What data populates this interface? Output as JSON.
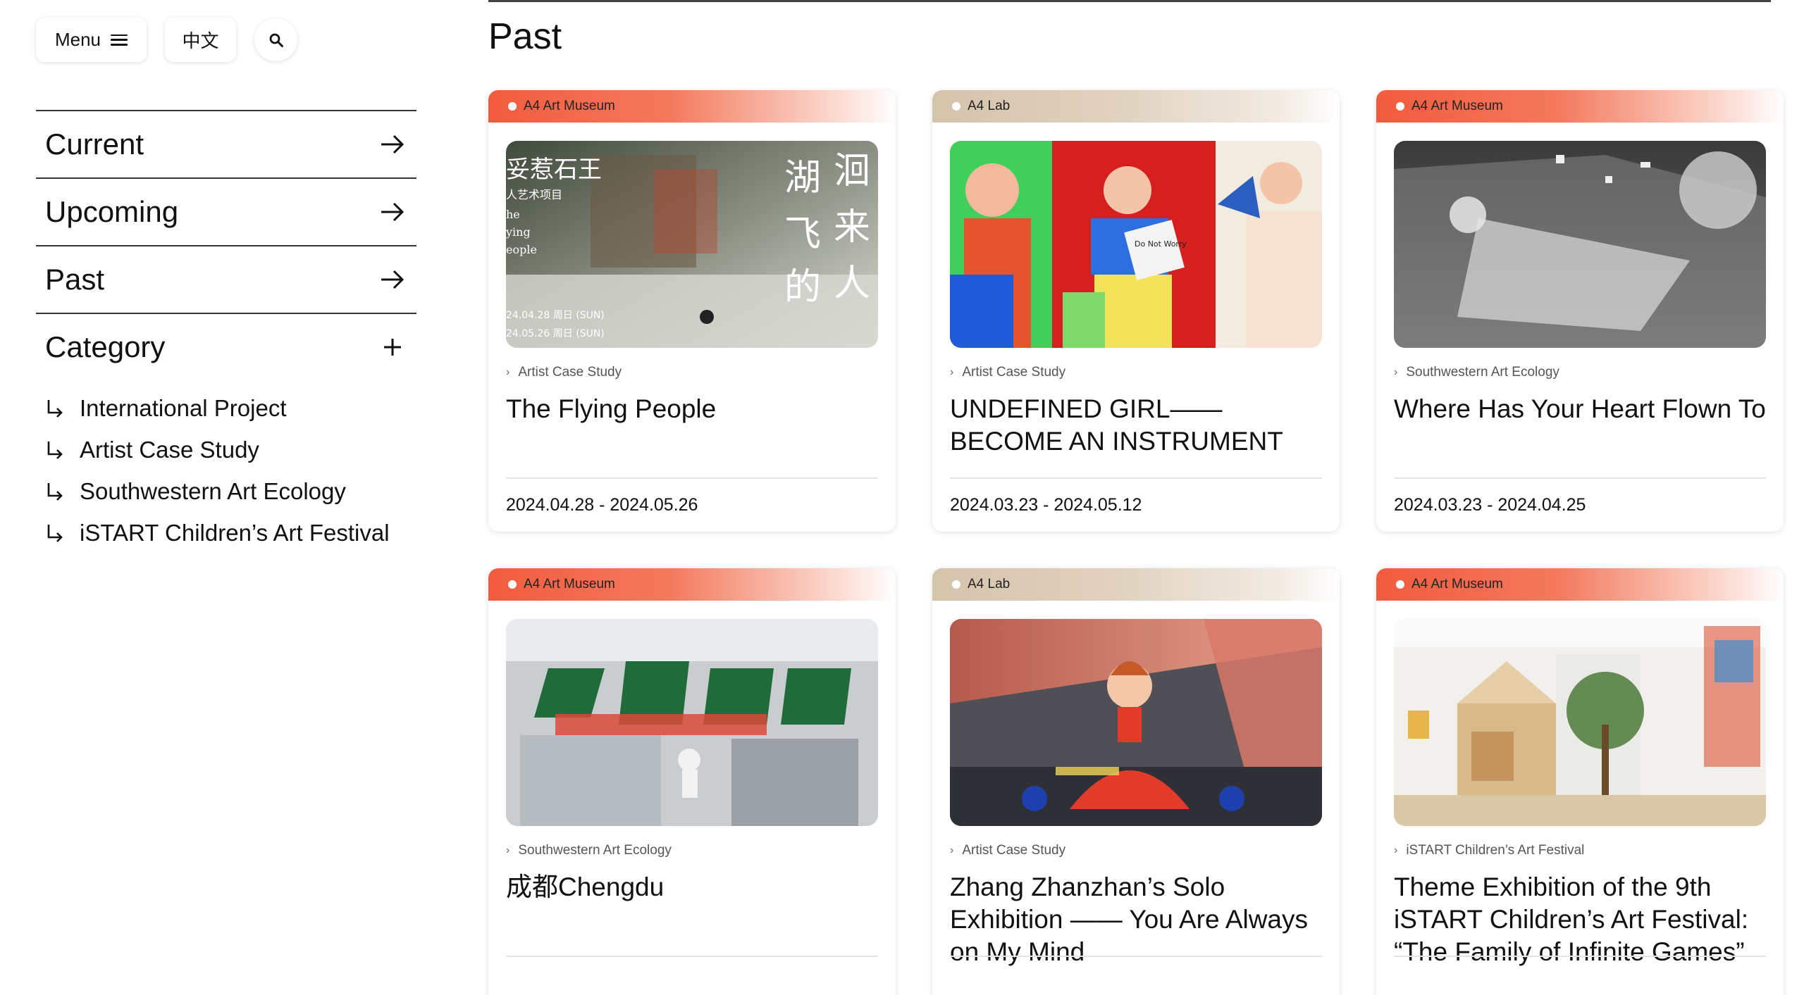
{
  "header": {
    "menu_label": "Menu",
    "lang_label": "中文"
  },
  "sidebar": {
    "nav": [
      {
        "label": "Current"
      },
      {
        "label": "Upcoming"
      },
      {
        "label": "Past"
      },
      {
        "label": "Category"
      }
    ],
    "categories": [
      {
        "label": "International Project"
      },
      {
        "label": "Artist Case Study"
      },
      {
        "label": "Southwestern Art Ecology"
      },
      {
        "label": "iSTART Children’s Art Festival"
      }
    ]
  },
  "main": {
    "title": "Past",
    "cards": [
      {
        "venue": "A4 Art Museum",
        "category": "Artist Case Study",
        "title": "The Flying People",
        "date": "2024.04.28 - 2024.05.26",
        "poster_text": [
          "湖",
          "飞",
          "的",
          "洄",
          "来",
          "人",
          "妥惹石王",
          "人艺术项目",
          "he",
          "ying",
          "eople",
          "24.04.28 周日 (SUN)",
          "24.05.26 周日 (SUN)"
        ]
      },
      {
        "venue": "A4 Lab",
        "category": "Artist Case Study",
        "title": "UNDEFINED GIRL—— BECOME AN INSTRUMENT",
        "date": "2024.03.23 - 2024.05.12",
        "poster_text": [
          "Do Not Worry"
        ]
      },
      {
        "venue": "A4 Art Museum",
        "category": "Southwestern Art Ecology",
        "title": "Where Has Your Heart Flown To",
        "date": "2024.03.23 - 2024.04.25"
      },
      {
        "venue": "A4 Art Museum",
        "category": "Southwestern Art Ecology",
        "title": "成都Chengdu",
        "date": ""
      },
      {
        "venue": "A4 Lab",
        "category": "Artist Case Study",
        "title": "Zhang Zhanzhan’s Solo Exhibition —— You Are Always on My Mind",
        "date": ""
      },
      {
        "venue": "A4 Art Museum",
        "category": "iSTART Children’s Art Festival",
        "title": "Theme Exhibition of the 9th iSTART Children’s Art Festival: “The Family of Infinite Games”",
        "date": ""
      }
    ]
  },
  "colors": {
    "museum_tag": "#f25b3e",
    "lab_tag": "#d5c3ab",
    "text": "#111111"
  }
}
